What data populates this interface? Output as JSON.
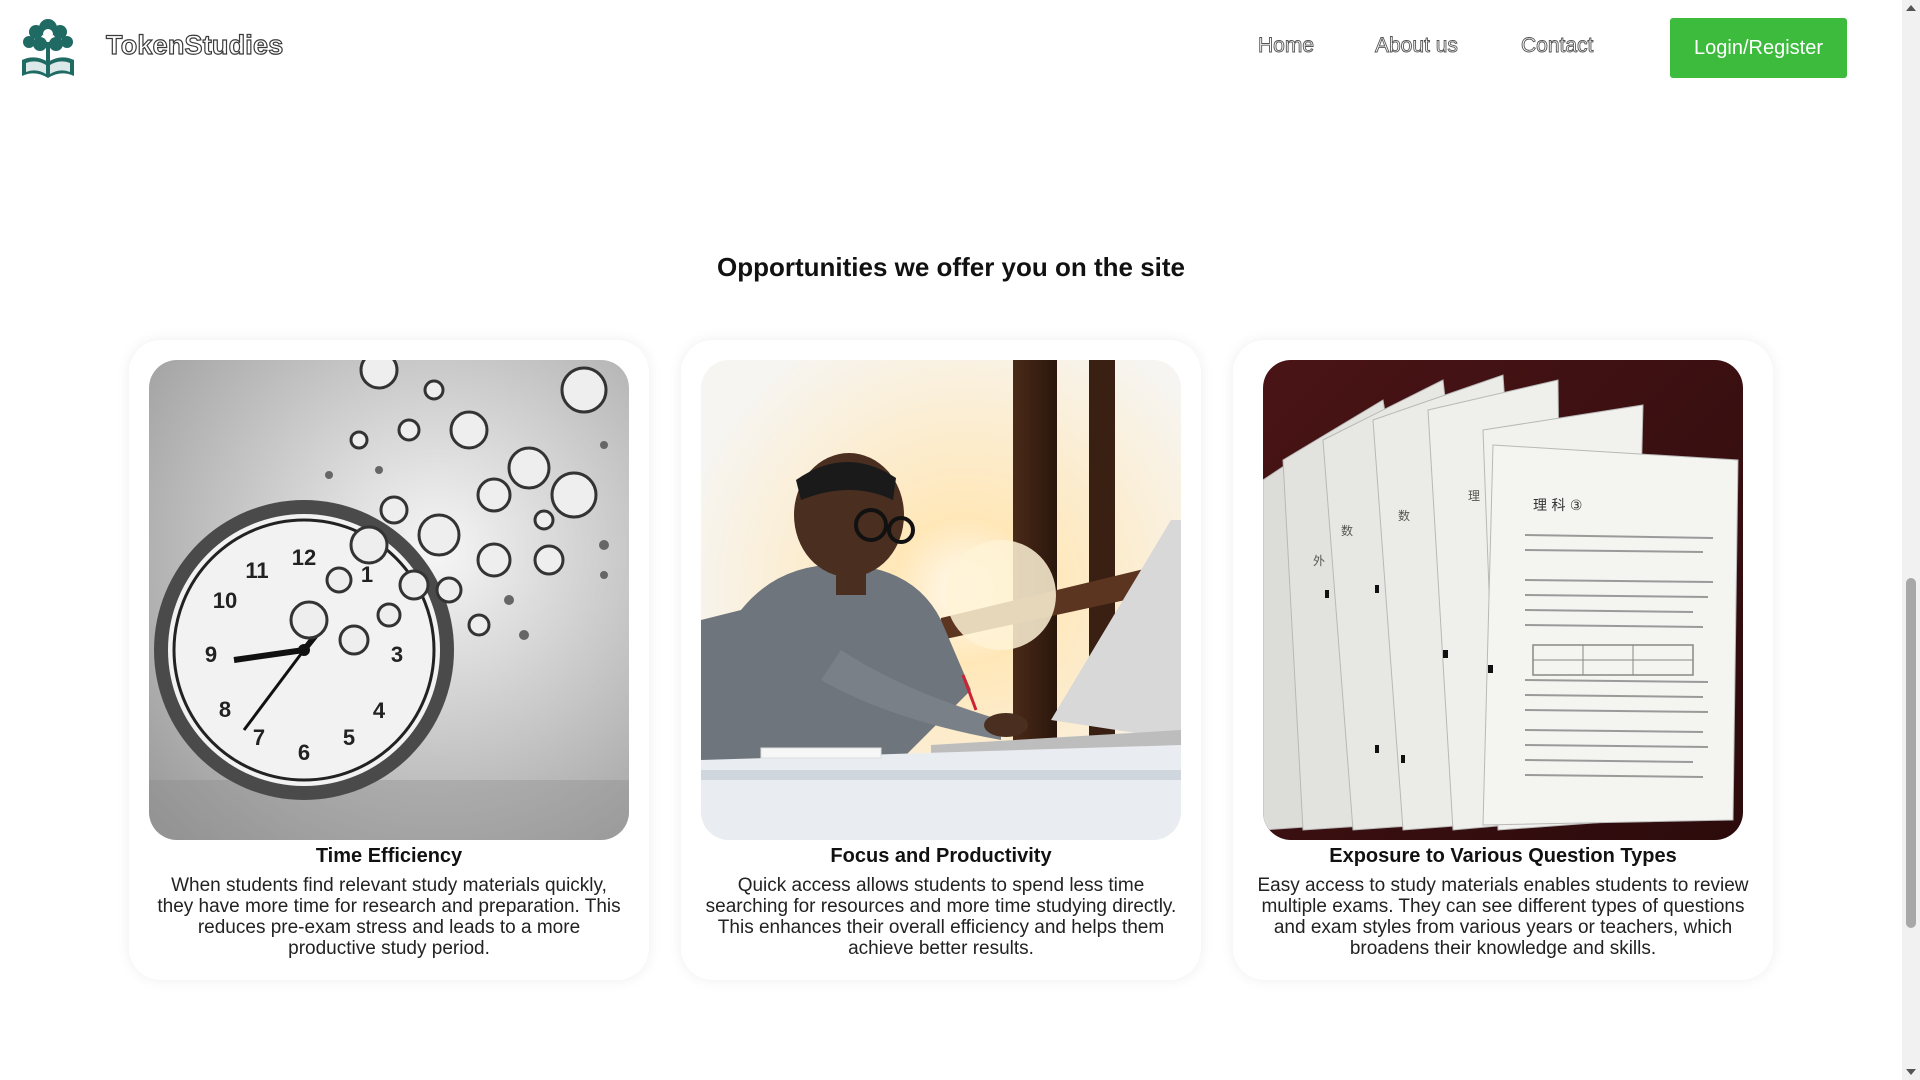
{
  "header": {
    "brand": "TokenStudies",
    "logo_icon": "tree-book-logo-icon",
    "nav": [
      {
        "label": "Home"
      },
      {
        "label": "About us"
      },
      {
        "label": "Contact"
      }
    ],
    "login_label": "Login/Register",
    "accent_color": "#3dbb3d"
  },
  "section": {
    "title": "Opportunities we offer you on the site",
    "cards": [
      {
        "image": "clocks-image",
        "title": "Time Efficiency",
        "text": "When students find relevant study materials quickly, they have more time for research and preparation. This reduces pre-exam stress and leads to a more productive study period."
      },
      {
        "image": "student-laptop-image",
        "title": "Focus and Productivity",
        "text": "Quick access allows students to spend less time searching for resources and more time studying directly. This enhances their overall efficiency and helps them achieve better results."
      },
      {
        "image": "exam-papers-image",
        "title": "Exposure to Various Question Types",
        "text": "Easy access to study materials enables students to review multiple exams. They can see different types of questions and exam styles from various years or teachers, which broadens their knowledge and skills."
      }
    ]
  }
}
